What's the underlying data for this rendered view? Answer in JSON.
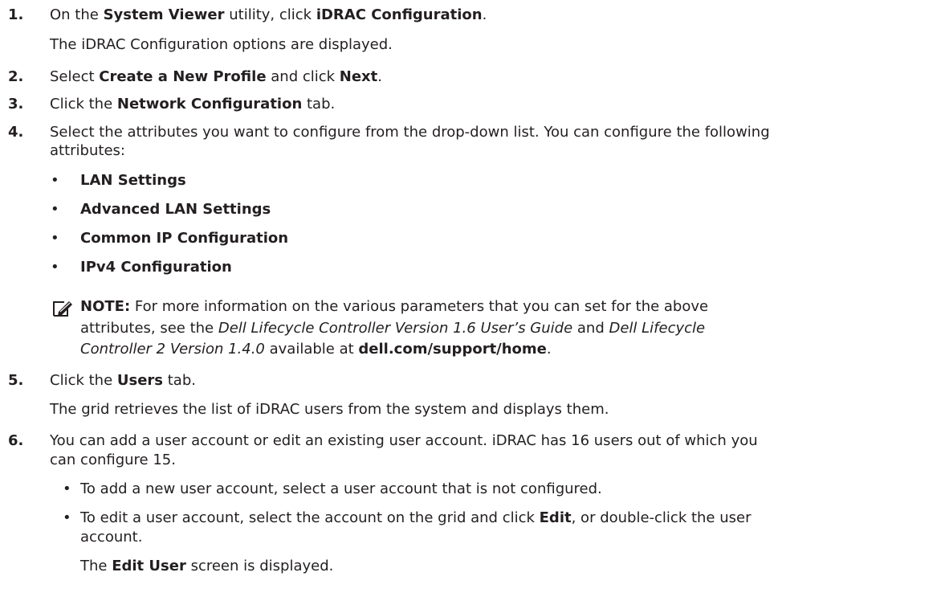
{
  "steps": [
    {
      "num": "1.",
      "pre": "On the ",
      "b1": "System Viewer",
      "mid": " utility, click ",
      "b2": "iDRAC Configuration",
      "post": ".",
      "result": "The iDRAC Configuration options are displayed."
    },
    {
      "num": "2.",
      "pre": "Select ",
      "b1": "Create a New Profile",
      "mid": " and click ",
      "b2": "Next",
      "post": "."
    },
    {
      "num": "3.",
      "pre": "Click the ",
      "b1": "Network Configuration",
      "post": " tab."
    },
    {
      "num": "4.",
      "line1": "Select the attributes you want to configure from the drop-down list. You can configure the following",
      "line2": "attributes:"
    },
    {
      "num": "5.",
      "pre": "Click the ",
      "b1": "Users",
      "post": " tab.",
      "result": "The grid retrieves the list of iDRAC users from the system and displays them."
    },
    {
      "num": "6.",
      "line1": "You can add a user account or edit an existing user account. iDRAC has 16 users out of which you",
      "line2": "can configure 15."
    }
  ],
  "attributes": [
    "LAN Settings",
    "Advanced LAN Settings",
    "Common IP Configuration",
    "IPv4 Configuration"
  ],
  "bullet_char": "•",
  "note": {
    "label": "NOTE:",
    "l1": " For more information on the various parameters that you can set for the above",
    "l2a": "attributes, see the ",
    "l2i1": "Dell Lifecycle Controller Version 1.6 User’s Guide",
    "l2b": " and ",
    "l2i2": "Dell Lifecycle",
    "l3i": "Controller 2 Version 1.4.0",
    "l3a": " available at ",
    "l3link": "dell.com/support/home",
    "l3end": "."
  },
  "user_bullets": {
    "b1": "To add a new user account, select a user account that is not configured.",
    "b2_l1_pre": "To edit a user account, select the account on the grid and click ",
    "b2_l1_bold": "Edit",
    "b2_l1_post": ", or double-click the user",
    "b2_l2": "account.",
    "result_pre": "The ",
    "result_bold": "Edit User",
    "result_post": " screen is displayed."
  }
}
